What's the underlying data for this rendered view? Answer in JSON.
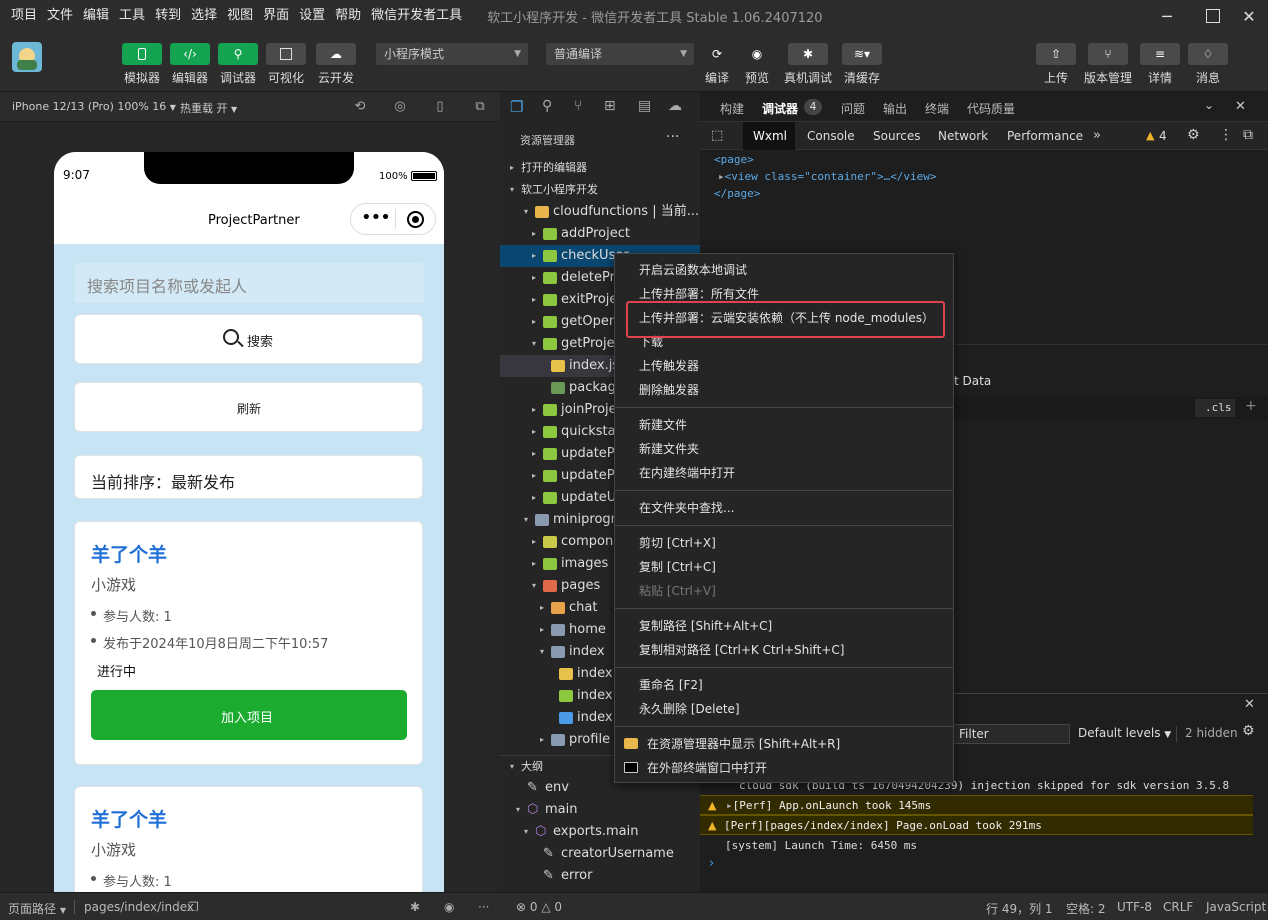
{
  "menu": [
    "项目",
    "文件",
    "编辑",
    "工具",
    "转到",
    "选择",
    "视图",
    "界面",
    "设置",
    "帮助",
    "微信开发者工具"
  ],
  "window_title": "软工小程序开发 - 微信开发者工具 Stable 1.06.2407120",
  "toolbar": {
    "simulator": "模拟器",
    "editor": "编辑器",
    "debugger": "调试器",
    "visual": "可视化",
    "cloud": "云开发",
    "mode_select": "小程序模式",
    "compile_select": "普通编译",
    "compile": "编译",
    "preview": "预览",
    "device_debug": "真机调试",
    "clear_cache": "清缓存",
    "upload": "上传",
    "version": "版本管理",
    "details": "详情",
    "messages": "消息"
  },
  "sim": {
    "device": "iPhone 12/13 (Pro) 100% 16",
    "hot_reload": "热重载 开",
    "time": "9:07",
    "battery": "100%",
    "nav_title": "ProjectPartner",
    "search_placeholder": "搜索项目名称或发起人",
    "search_btn": "搜索",
    "refresh_btn": "刷新",
    "sort_text": "当前排序：最新发布",
    "cards": [
      {
        "title": "羊了个羊",
        "subtitle": "小游戏",
        "members": "参与人数: 1",
        "date": "发布于2024年10月8日周二下午10:57",
        "status": "进行中",
        "join": "加入项目"
      },
      {
        "title": "羊了个羊",
        "subtitle": "小游戏",
        "members": "参与人数: 1"
      }
    ]
  },
  "explorer": {
    "title": "资源管理器",
    "open_editors": "打开的编辑器",
    "project": "软工小程序开发",
    "outline": "大纲",
    "items": [
      {
        "label": "cloudfunctions | 当前...",
        "indent": 2,
        "caret": "▾",
        "color": "#e8b64a"
      },
      {
        "label": "addProject",
        "indent": 3,
        "caret": "▸",
        "color": "#8dc63f"
      },
      {
        "label": "checkUser",
        "indent": 3,
        "caret": "▸",
        "color": "#8dc63f",
        "selected": true
      },
      {
        "label": "deleteProject",
        "indent": 3,
        "caret": "▸",
        "color": "#8dc63f"
      },
      {
        "label": "exitProject",
        "indent": 3,
        "caret": "▸",
        "color": "#8dc63f"
      },
      {
        "label": "getOpenId",
        "indent": 3,
        "caret": "▸",
        "color": "#8dc63f"
      },
      {
        "label": "getProject",
        "indent": 3,
        "caret": "▾",
        "color": "#8dc63f"
      },
      {
        "label": "index.js",
        "indent": 4,
        "caret": "",
        "color": "#e8c14a",
        "active": true
      },
      {
        "label": "package.json",
        "indent": 4,
        "caret": "",
        "color": "#6a9955"
      },
      {
        "label": "joinProject",
        "indent": 3,
        "caret": "▸",
        "color": "#8dc63f"
      },
      {
        "label": "quickstart",
        "indent": 3,
        "caret": "▸",
        "color": "#8dc63f"
      },
      {
        "label": "updateProject",
        "indent": 3,
        "caret": "▸",
        "color": "#8dc63f"
      },
      {
        "label": "updateProject2",
        "indent": 3,
        "caret": "▸",
        "color": "#8dc63f"
      },
      {
        "label": "updateUser",
        "indent": 3,
        "caret": "▸",
        "color": "#8dc63f"
      },
      {
        "label": "miniprogram",
        "indent": 2,
        "caret": "▾",
        "color": "#8a9bb0"
      },
      {
        "label": "components",
        "indent": 3,
        "caret": "▸",
        "color": "#c9c94a"
      },
      {
        "label": "images",
        "indent": 3,
        "caret": "▸",
        "color": "#8dc63f"
      },
      {
        "label": "pages",
        "indent": 3,
        "caret": "▾",
        "color": "#e26a4a"
      },
      {
        "label": "chat",
        "indent": 4,
        "caret": "▸",
        "color": "#e8a24a"
      },
      {
        "label": "home",
        "indent": 4,
        "caret": "▸",
        "color": "#8a9bb0"
      },
      {
        "label": "index",
        "indent": 4,
        "caret": "▾",
        "color": "#8a9bb0"
      },
      {
        "label": "index.js",
        "indent": 5,
        "caret": "",
        "color": "#e8c14a"
      },
      {
        "label": "index.json",
        "indent": 5,
        "caret": "",
        "color": "#8dc63f"
      },
      {
        "label": "index.wxss",
        "indent": 5,
        "caret": "",
        "color": "#4a9be8"
      },
      {
        "label": "profile",
        "indent": 4,
        "caret": "▸",
        "color": "#8a9bb0"
      }
    ],
    "outline_items": [
      {
        "label": "env",
        "indent": 1,
        "caret": ""
      },
      {
        "label": "main",
        "indent": 1,
        "caret": "▾"
      },
      {
        "label": "exports.main",
        "indent": 2,
        "caret": "▾"
      },
      {
        "label": "creatorUsername",
        "indent": 3,
        "caret": ""
      },
      {
        "label": "error",
        "indent": 3,
        "caret": ""
      }
    ]
  },
  "devtools": {
    "top_tabs": [
      "构建",
      "调试器",
      "问题",
      "输出",
      "终端",
      "代码质量"
    ],
    "debugger_badge": "4",
    "tabs": [
      "Wxml",
      "Console",
      "Sources",
      "Network",
      "Performance"
    ],
    "warn_count": "4",
    "wxml": [
      "<page>",
      "<view class=\"container\">…</view>",
      "</page>"
    ],
    "styles_label": "t Data",
    "cls": ".cls",
    "console": {
      "filter_placeholder": "Filter",
      "levels": "Default levels",
      "hidden": "2 hidden",
      "lines": [
        {
          "text": "cloud sdk (build ts 1670494204239) injection skipped for sdk version 3.5.8",
          "warn": false
        },
        {
          "text": "[Perf] App.onLaunch took 145ms",
          "warn": true
        },
        {
          "text": "[Perf][pages/index/index] Page.onLoad took 291ms",
          "warn": true
        },
        {
          "text": "[system] Launch Time: 6450 ms",
          "warn": false
        }
      ]
    }
  },
  "context_menu": {
    "groups": [
      [
        "开启云函数本地调试",
        "上传并部署：所有文件",
        "上传并部署：云端安装依赖（不上传 node_modules）",
        "下载",
        "上传触发器",
        "删除触发器"
      ],
      [
        "新建文件",
        "新建文件夹",
        "在内建终端中打开"
      ],
      [
        "在文件夹中查找..."
      ],
      [
        "剪切  [Ctrl+X]",
        "复制  [Ctrl+C]",
        "粘贴  [Ctrl+V]"
      ],
      [
        "复制路径  [Shift+Alt+C]",
        "复制相对路径  [Ctrl+K Ctrl+Shift+C]"
      ],
      [
        "重命名  [F2]",
        "永久删除  [Delete]"
      ],
      [
        "在资源管理器中显示  [Shift+Alt+R]",
        "在外部终端窗口中打开"
      ]
    ]
  },
  "statusbar": {
    "page_path_label": "页面路径",
    "page_path": "pages/index/index",
    "errors": "0",
    "warnings": "0",
    "position": "行 49，列 1",
    "spaces": "空格: 2",
    "encoding": "UTF-8",
    "eol": "CRLF",
    "language": "JavaScript"
  },
  "colors": {
    "accent_green": "#14a350",
    "highlight_red": "#e0424f",
    "link_blue": "#1f6fd6"
  }
}
